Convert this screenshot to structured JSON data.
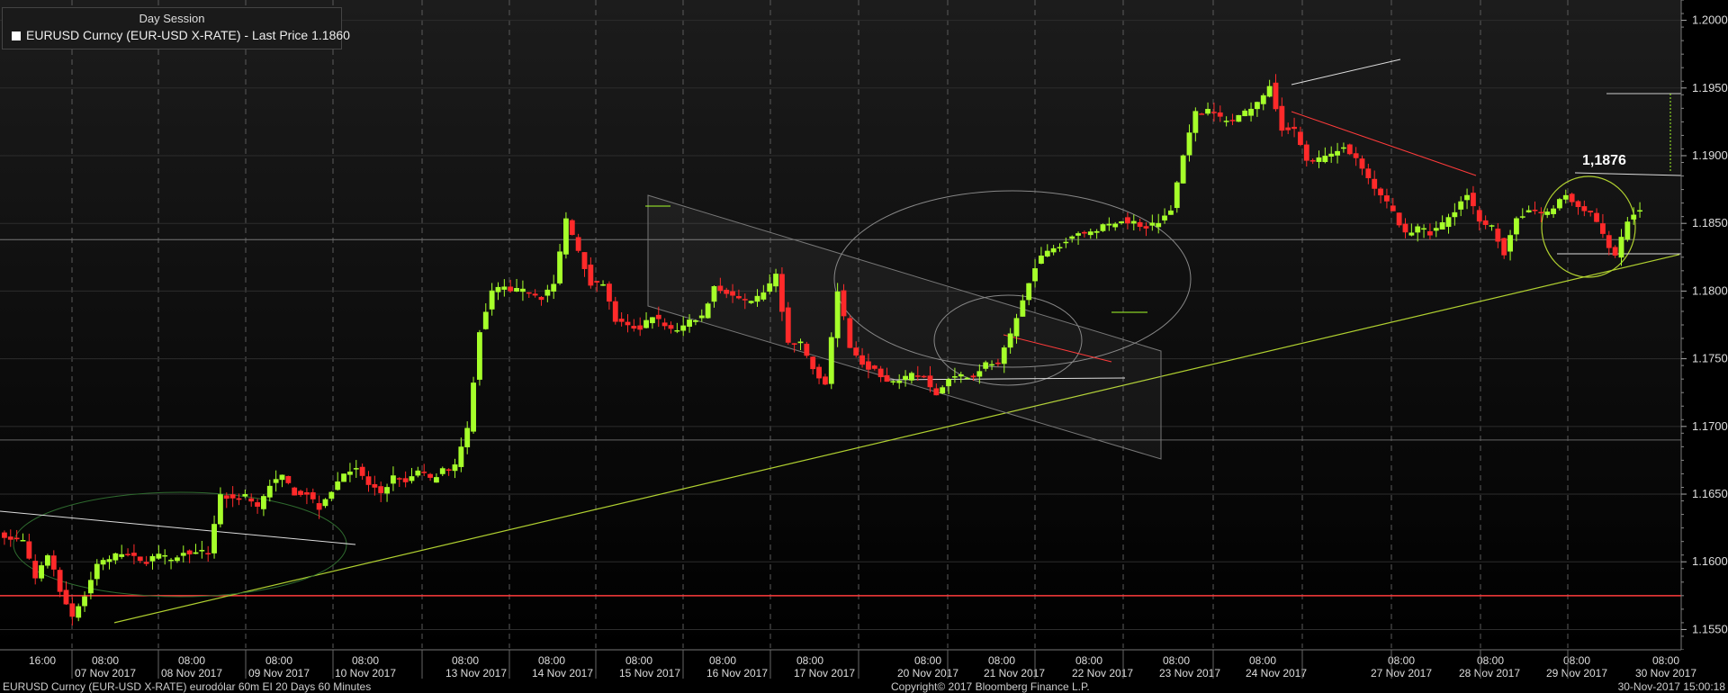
{
  "legend": {
    "session": "Day Session",
    "series_label": "EURUSD Curncy (EUR-USD X-RATE) - Last Price 1.1860",
    "swatch_color": "#ffffff"
  },
  "annotation_label": "1,1876",
  "footer": {
    "left": "EURUSD Curncy (EUR-USD X-RATE) eurodólar 60m EI 20 Days 60 Minutes",
    "center": "Copyright© 2017 Bloomberg Finance L.P.",
    "right": "30-Nov-2017 15:00:18"
  },
  "colors": {
    "up": "#a6ff2a",
    "down": "#ff2a2a",
    "support": "#b0d030",
    "level_line": "#ff3b3b",
    "grid": "#555555"
  },
  "chart_data": {
    "type": "candlestick",
    "title": "EURUSD Curncy (EUR-USD X-RATE) - Last Price 1.1860",
    "ylim": [
      1.1535,
      1.2015
    ],
    "y_ticks": [
      "1.2000",
      "1.1950",
      "1.1900",
      "1.1850",
      "1.1800",
      "1.1750",
      "1.1700",
      "1.1650",
      "1.1600",
      "1.1550"
    ],
    "x_time_labels": [
      "16:00",
      "08:00",
      "08:00",
      "08:00",
      "08:00",
      "08:00",
      "08:00",
      "08:00",
      "08:00",
      "08:00",
      "08:00",
      "08:00",
      "08:00",
      "08:00",
      "08:00",
      "08:00",
      "08:00",
      "08:00",
      "08:00"
    ],
    "x_date_labels": [
      "07 Nov 2017",
      "08 Nov 2017",
      "09 Nov 2017",
      "10 Nov 2017",
      "13 Nov 2017",
      "14 Nov 2017",
      "15 Nov 2017",
      "16 Nov 2017",
      "17 Nov 2017",
      "20 Nov 2017",
      "21 Nov 2017",
      "22 Nov 2017",
      "23 Nov 2017",
      "24 Nov 2017",
      "27 Nov 2017",
      "28 Nov 2017",
      "29 Nov 2017",
      "30 Nov 2017"
    ],
    "last_price": 1.186,
    "horizontal_levels": [
      1.1575,
      1.169,
      1.1838
    ],
    "trend_support": {
      "from": 1.1555,
      "to": 1.1827
    },
    "waypoints": [
      [
        1.162,
        1.1615,
        1.1585,
        1.1605,
        1.158,
        1.156,
        1.1575,
        1.16
      ],
      [
        1.16,
        1.1605,
        1.1602,
        1.1598,
        1.1605,
        1.16,
        1.1608,
        1.1605
      ],
      [
        1.1605,
        1.165,
        1.1645,
        1.165,
        1.164,
        1.166,
        1.1665,
        1.165
      ],
      [
        1.165,
        1.164,
        1.1655,
        1.1665,
        1.167,
        1.1655,
        1.165,
        1.166
      ],
      [
        1.166,
        1.1668,
        1.166,
        1.1665,
        1.1668,
        1.17,
        1.177,
        1.18
      ],
      [
        1.18,
        1.1798,
        1.1802,
        1.1795,
        1.1805,
        1.185,
        1.183,
        1.1805
      ],
      [
        1.1805,
        1.178,
        1.1775,
        1.177,
        1.178,
        1.1772,
        1.177,
        1.178
      ],
      [
        1.178,
        1.1805,
        1.18,
        1.1795,
        1.179,
        1.18,
        1.181,
        1.176
      ],
      [
        1.176,
        1.174,
        1.173,
        1.18,
        1.176,
        1.1745,
        1.174,
        1.1735
      ],
      [
        1.1735,
        1.174,
        1.1735,
        1.1725,
        1.1735,
        1.174,
        1.1738,
        1.1745
      ],
      [
        1.1745,
        1.1765,
        1.179,
        1.182,
        1.183,
        1.1835,
        1.184,
        1.1845
      ],
      [
        1.1845,
        1.1848,
        1.185,
        1.185,
        1.1845,
        1.185,
        1.186,
        1.19
      ],
      [
        1.193,
        1.1935,
        1.193,
        1.1925,
        1.193,
        1.194,
        1.195,
        1.192
      ],
      [
        1.192,
        1.19,
        1.1895,
        1.19,
        1.1905,
        1.1895,
        1.188,
        1.187
      ],
      [
        1.186,
        1.184,
        1.185,
        1.1845,
        1.185,
        1.186,
        1.187,
        1.185
      ],
      [
        1.185,
        1.183,
        1.1855,
        1.186,
        1.1858,
        1.186,
        1.187,
        1.186
      ],
      [
        1.186,
        1.184,
        1.1825,
        1.185,
        1.186
      ],
      []
    ]
  }
}
